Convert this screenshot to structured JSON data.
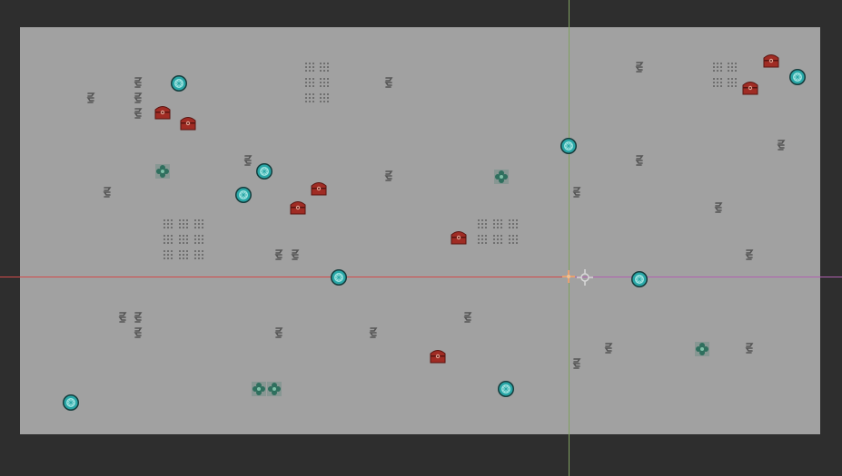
{
  "editor": {
    "colors": {
      "background": "#2e2e2e",
      "map": "#a1a1a1",
      "axis_x": "#d24b4b",
      "axis_x_positive": "#b060b0",
      "axis_y": "#7fa060"
    },
    "origin_marker": "crosshair-icon",
    "cursor_marker": "move-cursor-icon"
  },
  "legend": {
    "gem": "teal-orb",
    "chest": "red-treasure-chest",
    "grass": "green-clover-tile",
    "rock": "grey-squiggle-tile",
    "dots": "grey-dot-grid-tile"
  }
}
